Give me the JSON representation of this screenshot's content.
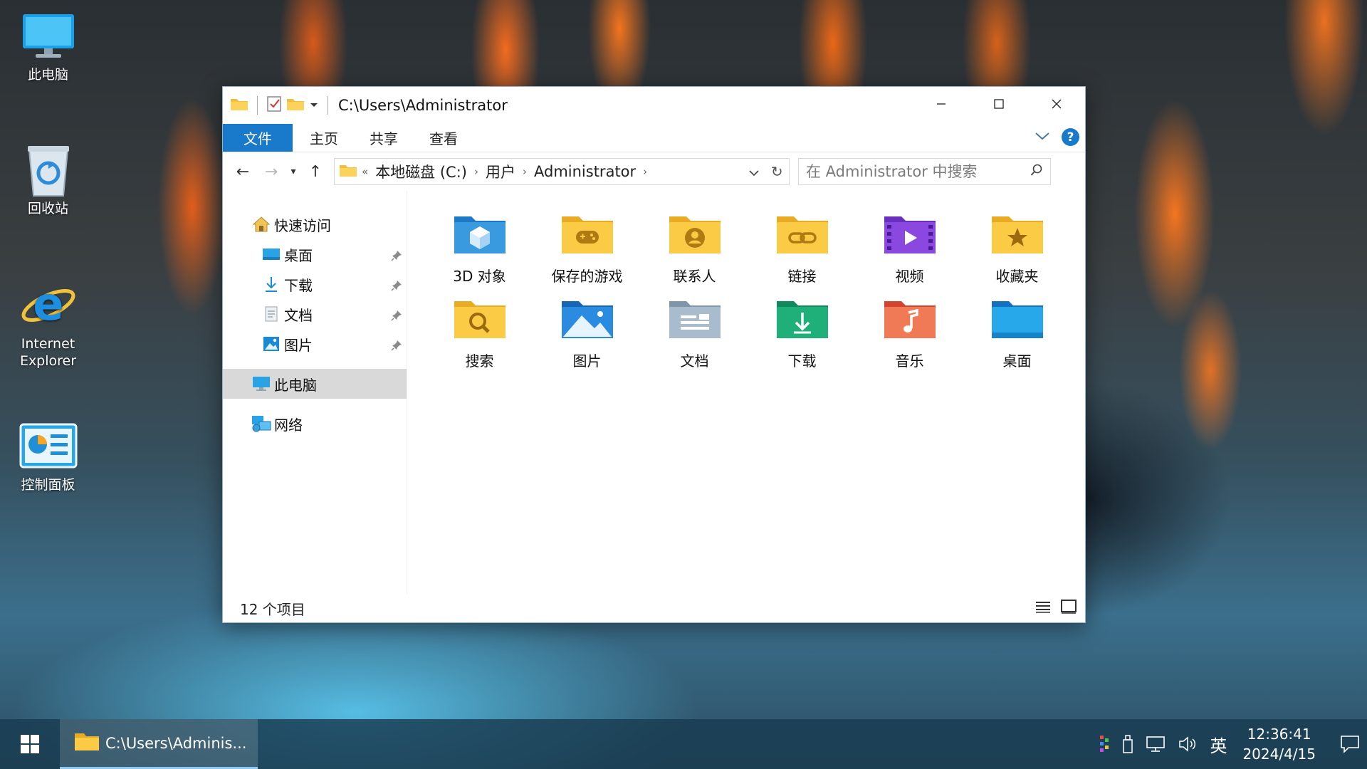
{
  "desktop": {
    "icons": [
      {
        "label": "此电脑"
      },
      {
        "label": "回收站"
      },
      {
        "label": "Internet Explorer"
      },
      {
        "label": "控制面板"
      }
    ]
  },
  "window": {
    "title": "C:\\Users\\Administrator",
    "ribbon_tabs": [
      "文件",
      "主页",
      "共享",
      "查看"
    ],
    "help_label": "?",
    "breadcrumb": [
      "本地磁盘 (C:)",
      "用户",
      "Administrator"
    ],
    "breadcrumb_overflow": "«",
    "search": {
      "placeholder": "在 Administrator 中搜索",
      "value": ""
    },
    "sidebar": {
      "quick_access": "快速访问",
      "pinned": [
        "桌面",
        "下载",
        "文档",
        "图片"
      ],
      "this_pc": "此电脑",
      "network": "网络"
    },
    "items": [
      {
        "label": "3D 对象",
        "icon": "3d-objects-folder-icon"
      },
      {
        "label": "保存的游戏",
        "icon": "saved-games-folder-icon"
      },
      {
        "label": "联系人",
        "icon": "contacts-folder-icon"
      },
      {
        "label": "链接",
        "icon": "links-folder-icon"
      },
      {
        "label": "视频",
        "icon": "videos-folder-icon"
      },
      {
        "label": "收藏夹",
        "icon": "favorites-folder-icon"
      },
      {
        "label": "搜索",
        "icon": "searches-folder-icon"
      },
      {
        "label": "图片",
        "icon": "pictures-folder-icon"
      },
      {
        "label": "文档",
        "icon": "documents-folder-icon"
      },
      {
        "label": "下载",
        "icon": "downloads-folder-icon"
      },
      {
        "label": "音乐",
        "icon": "music-folder-icon"
      },
      {
        "label": "桌面",
        "icon": "desktop-folder-icon"
      }
    ],
    "status": "12 个项目"
  },
  "taskbar": {
    "app_label": "C:\\Users\\Adminis...",
    "ime": "英",
    "time": "12:36:41",
    "date": "2024/4/15"
  },
  "colors": {
    "accent": "#1979ca",
    "folder_yellow": "#f8c53a",
    "selection": "#d9d9d9"
  }
}
